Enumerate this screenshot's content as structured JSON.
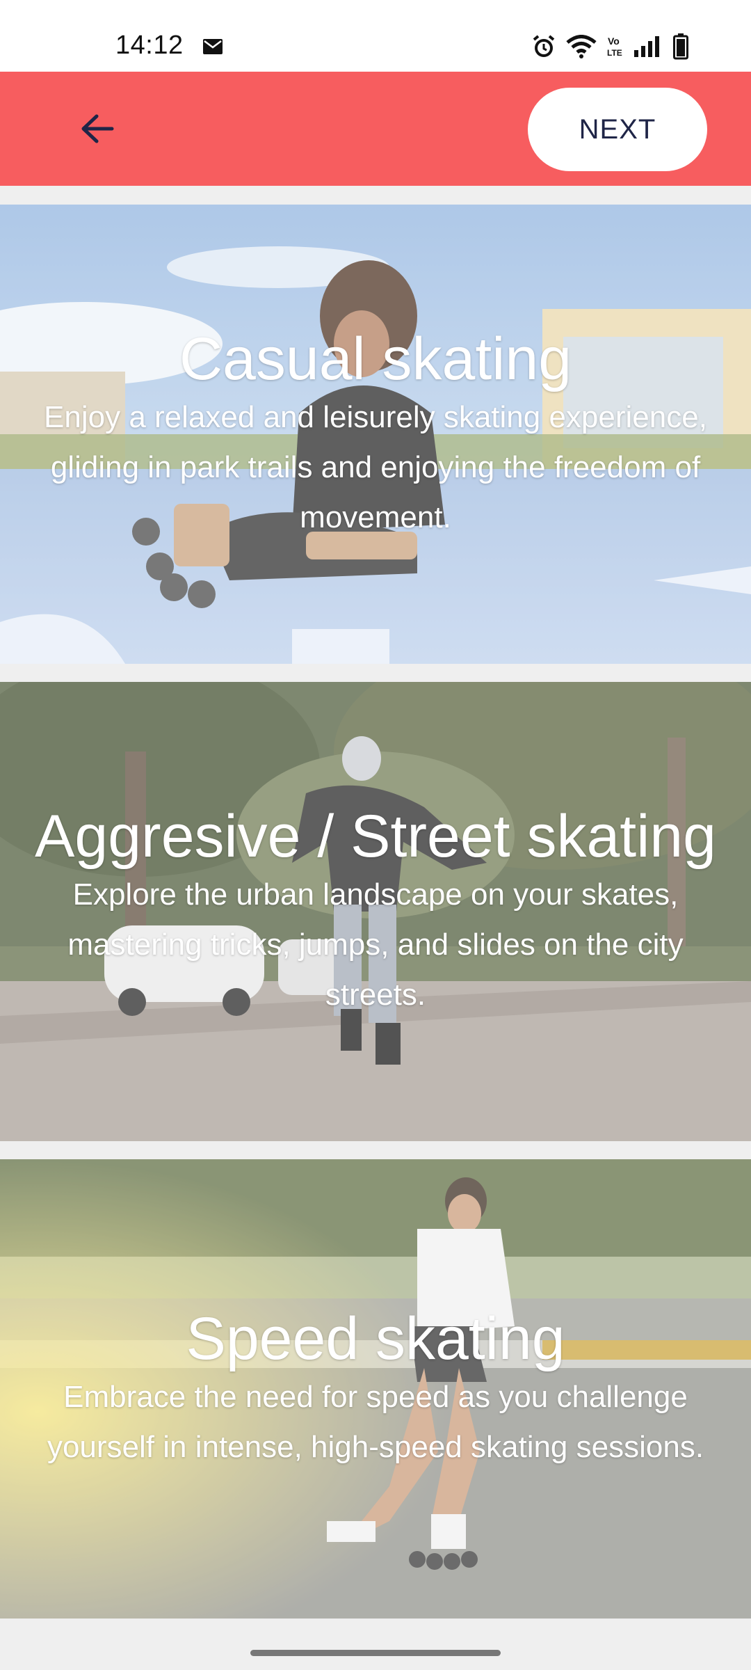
{
  "status_bar": {
    "time": "14:12",
    "icons": [
      "mail-icon",
      "alarm-icon",
      "wifi-icon",
      "volte-icon",
      "signal-icon",
      "battery-icon"
    ],
    "volte_text": "Vo LTE"
  },
  "app_bar": {
    "background_color": "#f75d5f",
    "back_icon": "arrow-left-icon",
    "next_label": "NEXT"
  },
  "cards": [
    {
      "title": "Casual skating",
      "description": "Enjoy a relaxed and leisurely skating experience, gliding in park trails and enjoying the freedom of movement."
    },
    {
      "title": "Aggresive / Street skating",
      "description": "Explore the urban landscape on your skates, mastering tricks, jumps, and slides on the city streets."
    },
    {
      "title": "Speed skating",
      "description": "Embrace the need for speed as you challenge yourself in intense, high-speed skating sessions."
    }
  ]
}
